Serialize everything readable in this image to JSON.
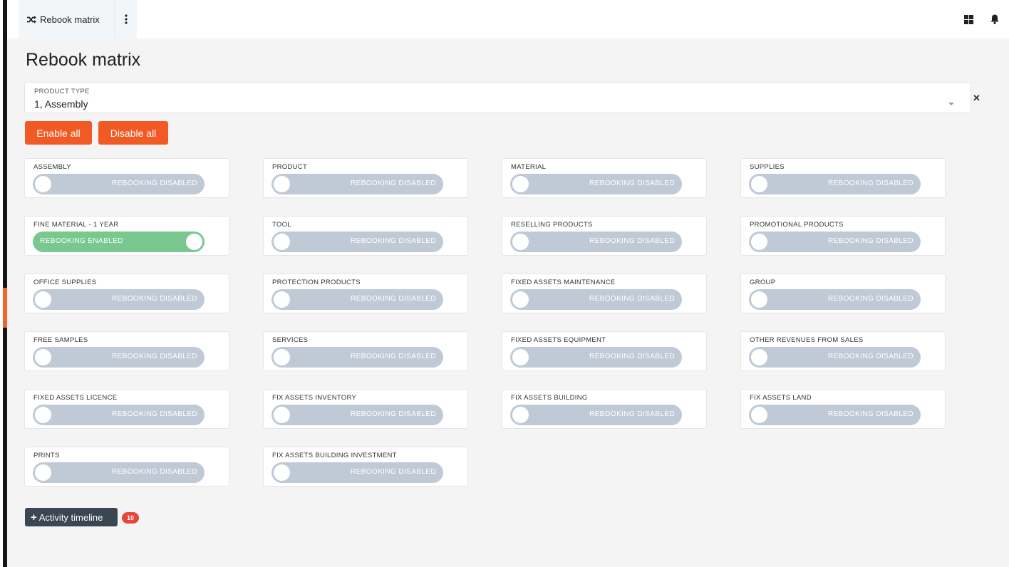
{
  "tab": {
    "title": "Rebook matrix",
    "icon": "shuffle-icon"
  },
  "header_icons": [
    "grid-icon",
    "bell-icon"
  ],
  "page": {
    "title": "Rebook matrix"
  },
  "product_type": {
    "label": "PRODUCT TYPE",
    "value": "1, Assembly"
  },
  "buttons": {
    "enable_all": "Enable all",
    "disable_all": "Disable all"
  },
  "colors": {
    "accent": "#f15a24",
    "toggle_disabled": "#c0cad6",
    "toggle_enabled": "#78c88f",
    "badge": "#e8453c",
    "dark_button": "#3a4651"
  },
  "items": [
    {
      "label": "ASSEMBLY",
      "status": "REBOOKING DISABLED",
      "enabled": false
    },
    {
      "label": "PRODUCT",
      "status": "REBOOKING DISABLED",
      "enabled": false
    },
    {
      "label": "MATERIAL",
      "status": "REBOOKING DISABLED",
      "enabled": false
    },
    {
      "label": "SUPPLIES",
      "status": "REBOOKING DISABLED",
      "enabled": false
    },
    {
      "label": "FINE MATERIAL - 1 YEAR",
      "status": "REBOOKING ENABLED",
      "enabled": true
    },
    {
      "label": "TOOL",
      "status": "REBOOKING DISABLED",
      "enabled": false
    },
    {
      "label": "RESELLING PRODUCTS",
      "status": "REBOOKING DISABLED",
      "enabled": false
    },
    {
      "label": "PROMOTIONAL PRODUCTS",
      "status": "REBOOKING DISABLED",
      "enabled": false
    },
    {
      "label": "OFFICE SUPPLIES",
      "status": "REBOOKING DISABLED",
      "enabled": false
    },
    {
      "label": "PROTECTION PRODUCTS",
      "status": "REBOOKING DISABLED",
      "enabled": false
    },
    {
      "label": "FIXED ASSETS MAINTENANCE",
      "status": "REBOOKING DISABLED",
      "enabled": false
    },
    {
      "label": "GROUP",
      "status": "REBOOKING DISABLED",
      "enabled": false
    },
    {
      "label": "FREE SAMPLES",
      "status": "REBOOKING DISABLED",
      "enabled": false
    },
    {
      "label": "SERVICES",
      "status": "REBOOKING DISABLED",
      "enabled": false
    },
    {
      "label": "FIXED ASSETS EQUIPMENT",
      "status": "REBOOKING DISABLED",
      "enabled": false
    },
    {
      "label": "OTHER REVENUES FROM SALES",
      "status": "REBOOKING DISABLED",
      "enabled": false
    },
    {
      "label": "FIXED ASSETS LICENCE",
      "status": "REBOOKING DISABLED",
      "enabled": false
    },
    {
      "label": "FIX ASSETS INVENTORY",
      "status": "REBOOKING DISABLED",
      "enabled": false
    },
    {
      "label": "FIX ASSETS BUILDING",
      "status": "REBOOKING DISABLED",
      "enabled": false
    },
    {
      "label": "FIX ASSETS LAND",
      "status": "REBOOKING DISABLED",
      "enabled": false
    },
    {
      "label": "PRINTS",
      "status": "REBOOKING DISABLED",
      "enabled": false
    },
    {
      "label": "FIX ASSETS BUILDING INVESTMENT",
      "status": "REBOOKING DISABLED",
      "enabled": false
    }
  ],
  "activity": {
    "label": "Activity timeline",
    "count": "10"
  }
}
